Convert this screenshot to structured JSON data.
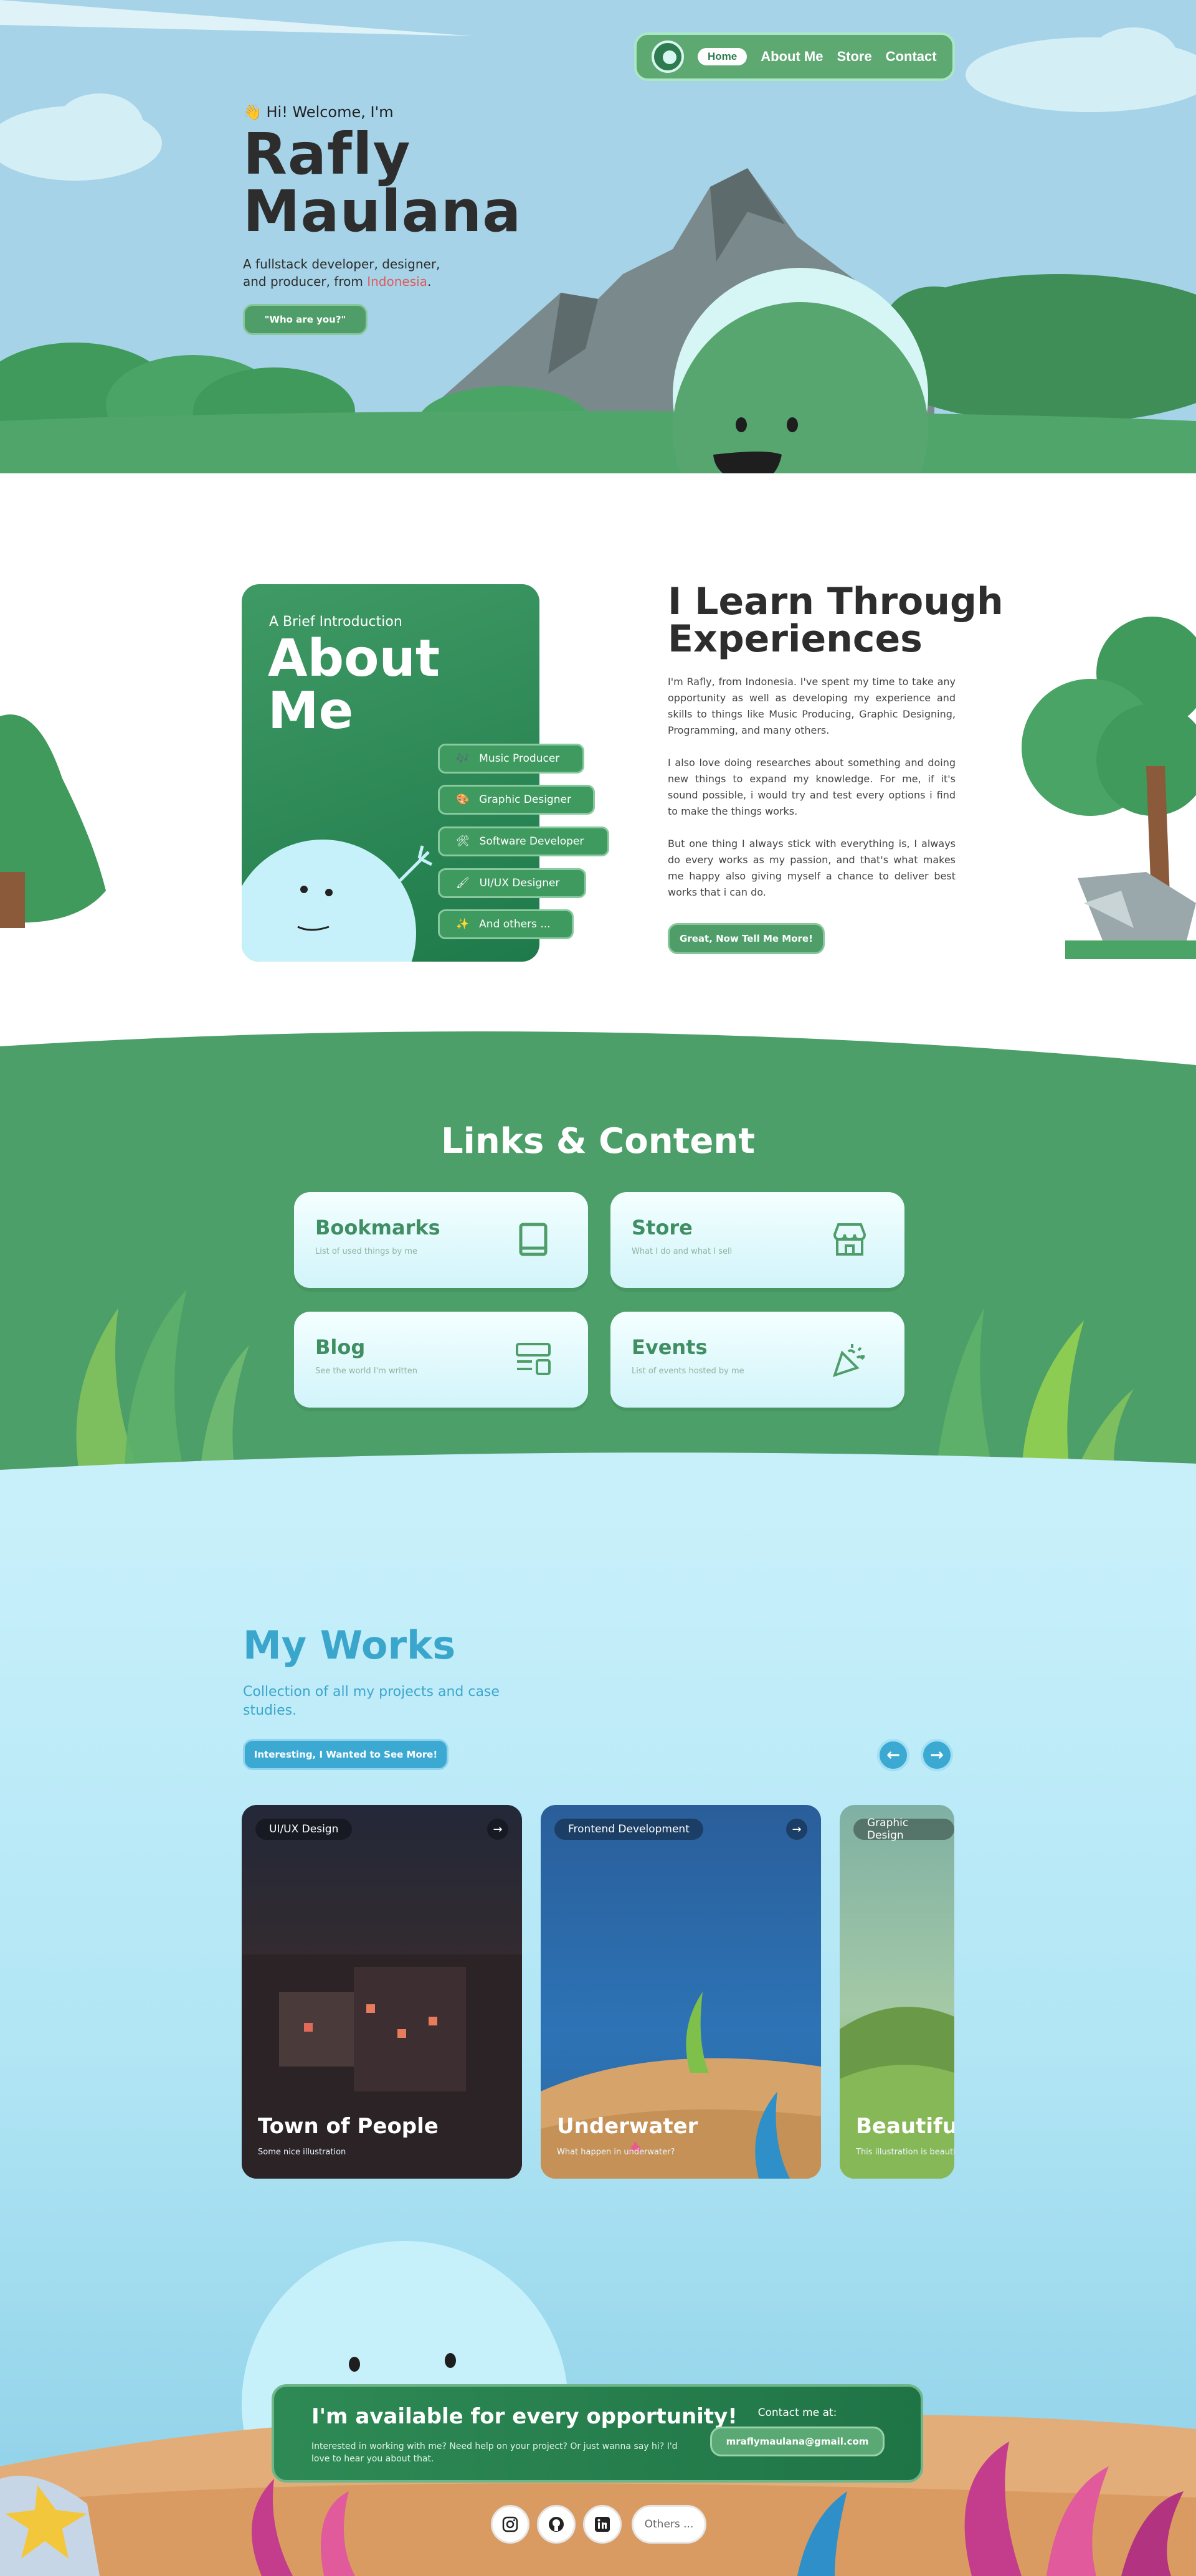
{
  "nav": {
    "items": [
      "Home",
      "About Me",
      "Store",
      "Contact"
    ]
  },
  "hero": {
    "greeting": "👋 Hi! Welcome, I'm",
    "name_line1": "Rafly",
    "name_line2": "Maulana",
    "desc_pre": "A fullstack developer, designer, and producer, from ",
    "desc_country": "Indonesia",
    "desc_post": ".",
    "cta": "\"Who are you?\""
  },
  "about": {
    "kicker": "A Brief Introduction",
    "title_line1": "About",
    "title_line2": "Me",
    "roles": [
      {
        "icon": "🎶",
        "label": "Music Producer"
      },
      {
        "icon": "🎨",
        "label": "Graphic Designer"
      },
      {
        "icon": "🛠",
        "label": "Software Developer"
      },
      {
        "icon": "🖌",
        "label": "UI/UX Designer"
      },
      {
        "icon": "✨",
        "label": "And others ..."
      }
    ],
    "heading_line1": "I Learn Through",
    "heading_line2": "Experiences",
    "para1": "I'm Rafly, from Indonesia. I've spent my time to take any opportunity as well as developing my experience and skills to things like Music Producing, Graphic Designing, Programming, and many others.",
    "para2": "I also love doing researches about something and doing new things to expand my knowledge. For me, if it's sound possible, i would try and test every options i find to make the things works.",
    "para3": "But one thing I always stick with everything is, I always do every works as my passion, and that's what makes me happy also giving myself a chance to deliver best works that i can do.",
    "button": "Great, Now Tell Me More!"
  },
  "links": {
    "heading": "Links & Content",
    "cards": [
      {
        "title": "Bookmarks",
        "sub": "List of used things by me",
        "icon": "book-icon"
      },
      {
        "title": "Store",
        "sub": "What I do and what I sell",
        "icon": "store-icon"
      },
      {
        "title": "Blog",
        "sub": "See the world I'm written",
        "icon": "layout-icon"
      },
      {
        "title": "Events",
        "sub": "List of events hosted by me",
        "icon": "party-popper-icon"
      }
    ]
  },
  "works": {
    "heading": "My Works",
    "subtitle": "Collection of all my projects and case studies.",
    "button": "Interesting, I Wanted to See More!",
    "prev": "←",
    "next": "→",
    "cards": [
      {
        "tag": "UI/UX Design",
        "title": "Town of People",
        "sub": "Some nice illustration",
        "go": "→"
      },
      {
        "tag": "Frontend Development",
        "title": "Underwater",
        "sub": "What happen in underwater?",
        "go": "→"
      },
      {
        "tag": "Graphic Design",
        "title": "Beautiful",
        "sub": "This illustration is beautiful",
        "go": "→"
      }
    ]
  },
  "contact": {
    "heading": "I'm available for every opportunity!",
    "text": "Interested in working with me? Need help on your project? Or just wanna say hi? I'd love to hear you about that.",
    "contact_label": "Contact me at:",
    "email": "mraflymaulana@gmail.com",
    "others": "Others ..."
  },
  "colors": {
    "primary_green": "#4f9d69",
    "dark_green": "#1e7a4a",
    "sky_blue": "#a6d3e8",
    "accent_blue": "#3ba9d2",
    "highlight_red": "#e05a5a"
  }
}
